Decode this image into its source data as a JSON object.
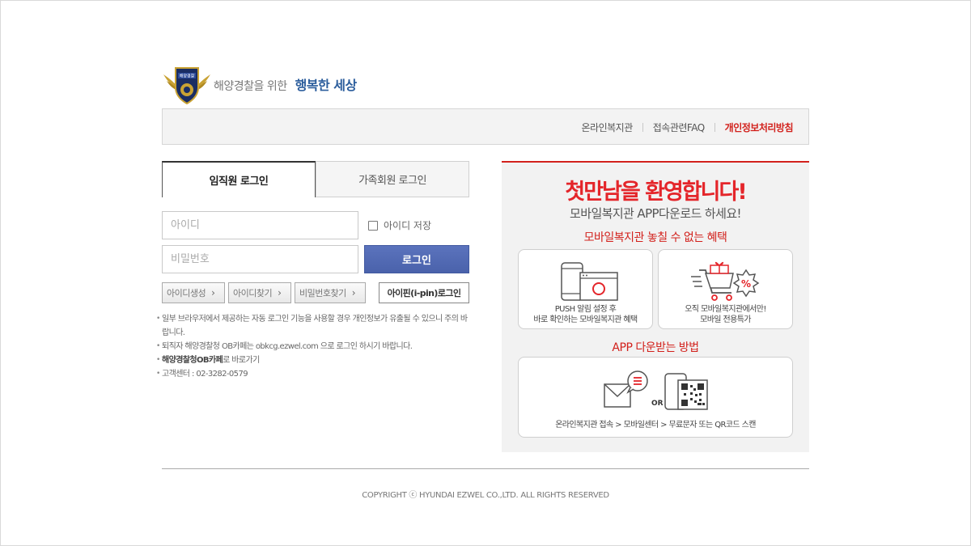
{
  "header": {
    "slogan_prefix": "해양경찰을 위한",
    "slogan_strong": "행복한 세상",
    "logo_text": "해양경찰"
  },
  "topbar": {
    "links": [
      "온라인복지관",
      "접속관련FAQ",
      "개인정보처리방침"
    ]
  },
  "login": {
    "tabs": [
      "임직원 로그인",
      "가족회원 로그인"
    ],
    "id_placeholder": "아이디",
    "pw_placeholder": "비밀번호",
    "save_id_label": "아이디 저장",
    "login_button": "로그인",
    "small_buttons": [
      "아이디생성",
      "아이디찾기",
      "비밀번호찾기"
    ],
    "ipin_button": "아이핀(i-pin)로그인",
    "notes": [
      "일부 브라우저에서 제공하는 자동 로그인 기능을 사용할 경우 개인정보가 유출될 수 있으니 주의 바랍니다.",
      "퇴직자 해양경찰청 OB카페는 obkcg.ezwel.com 으로 로그인 하시기 바랍니다.",
      "고객센터 : 02-3282-0579"
    ],
    "ob_link_bold": "해양경찰청OB카페",
    "ob_link_rest": "로 바로가기"
  },
  "promo": {
    "welcome": "첫만남을 환영합니다!",
    "subtitle": "모바일복지관 APP다운로드 하세요!",
    "benefits_title": "모바일복지관 놓칠 수 없는 혜택",
    "card1_line1": "PUSH 알림 설정 후",
    "card1_line2": "바로 확인하는 모바일복지관 혜택",
    "card2_line1": "오직 모바일복지관에서만!",
    "card2_line2": "모바일 전용특가",
    "how_title": "APP 다운받는 방법",
    "or_label": "OR",
    "how_text": "온라인복지관 접속 > 모바일센터 > 무료문자 또는 QR코드 스캔",
    "icons": [
      "phone-browser-icon",
      "shopping-cart-sale-icon",
      "sms-envelope-icon",
      "qr-phone-icon"
    ]
  },
  "footer": {
    "copyright": "COPYRIGHT ⓒ HYUNDAI EZWEL CO.,LTD. ALL RIGHTS RESERVED"
  },
  "colors": {
    "accent_red": "#d2211c",
    "login_blue": "#4a62ab",
    "slogan_blue": "#2b5d9c"
  }
}
